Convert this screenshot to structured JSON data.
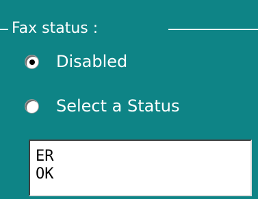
{
  "fax_status_group": {
    "legend": "Fax status :",
    "options": [
      {
        "label": "Disabled",
        "selected": true
      },
      {
        "label": "Select a Status",
        "selected": false
      }
    ],
    "status_list": {
      "items": [
        "ER",
        "OK"
      ]
    }
  }
}
